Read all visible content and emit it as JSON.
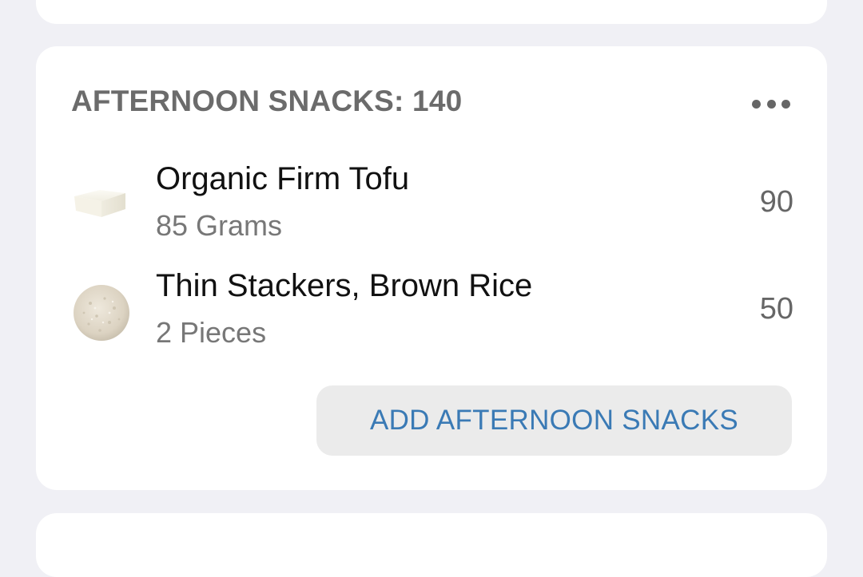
{
  "meal_section": {
    "title": "AFTERNOON SNACKS: 140",
    "more_icon": "more-horizontal-icon",
    "items": [
      {
        "name": "Organic Firm Tofu",
        "serving": "85 Grams",
        "calories": "90",
        "thumbnail": "tofu-image"
      },
      {
        "name": "Thin Stackers, Brown Rice",
        "serving": "2 Pieces",
        "calories": "50",
        "thumbnail": "rice-cake-image"
      }
    ],
    "add_button_label": "ADD AFTERNOON SNACKS"
  },
  "colors": {
    "background": "#f0f0f5",
    "card": "#ffffff",
    "title_text": "#6b6b6b",
    "add_button_text": "#3a7ab5",
    "add_button_bg": "#ebebeb"
  }
}
